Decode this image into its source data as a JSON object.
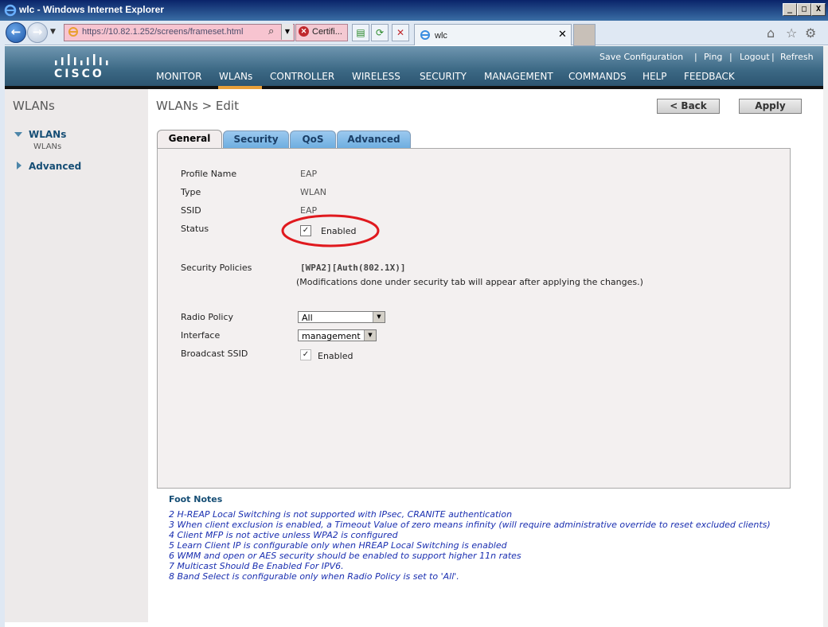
{
  "window": {
    "title": "wlc - Windows Internet Explorer",
    "buttons": [
      "_",
      "□",
      "X"
    ]
  },
  "browser": {
    "address": "https://10.82.1.252/screens/frameset.html",
    "cert_label": "Certifi...",
    "tab_label": "wlc",
    "tab_close": "✕"
  },
  "header": {
    "brand": "CISCO",
    "top_links": [
      "Save Configuration",
      "Ping",
      "Logout",
      "Refresh"
    ],
    "menu": [
      "MONITOR",
      "WLANs",
      "CONTROLLER",
      "WIRELESS",
      "SECURITY",
      "MANAGEMENT",
      "COMMANDS",
      "HELP",
      "FEEDBACK"
    ],
    "active_menu": "WLANs"
  },
  "sidebar": {
    "title": "WLANs",
    "items": [
      {
        "label": "WLANs",
        "expanded": true,
        "sub": [
          "WLANs"
        ]
      },
      {
        "label": "Advanced",
        "expanded": false
      }
    ]
  },
  "page": {
    "title": "WLANs > Edit",
    "back_label": "< Back",
    "apply_label": "Apply"
  },
  "tabs": [
    "General",
    "Security",
    "QoS",
    "Advanced"
  ],
  "active_tab": "General",
  "form": {
    "profile_name_label": "Profile Name",
    "profile_name": "EAP",
    "type_label": "Type",
    "type": "WLAN",
    "ssid_label": "SSID",
    "ssid": "EAP",
    "status_label": "Status",
    "status_checked": true,
    "status_text": "Enabled",
    "security_policies_label": "Security Policies",
    "security_policies": "[WPA2][Auth(802.1X)]",
    "security_note": "(Modifications done under security tab will appear after applying the changes.)",
    "radio_policy_label": "Radio Policy",
    "radio_policy": "All",
    "interface_label": "Interface",
    "interface": "management",
    "broadcast_ssid_label": "Broadcast SSID",
    "broadcast_ssid_checked": true,
    "broadcast_ssid_text": "Enabled"
  },
  "footnotes": {
    "title": "Foot Notes",
    "items": [
      "2 H-REAP Local Switching is not supported with IPsec, CRANITE authentication",
      "3 When client exclusion is enabled, a Timeout Value of zero means infinity (will require administrative override to reset excluded clients)",
      "4 Client MFP is not active unless WPA2 is configured",
      "5 Learn Client IP is configurable only when HREAP Local Switching is enabled",
      "6 WMM and open or AES security should be enabled to support higher 11n rates",
      "7 Multicast Should Be Enabled For IPV6.",
      "8 Band Select is configurable only when Radio Policy is set to 'All'."
    ]
  },
  "colors": {
    "header": "#3c6985",
    "accent_underline": "#e8a03a",
    "link_blue": "#164e75",
    "footnote_blue": "#1a2fb0",
    "highlight_oval": "#e0191e"
  }
}
